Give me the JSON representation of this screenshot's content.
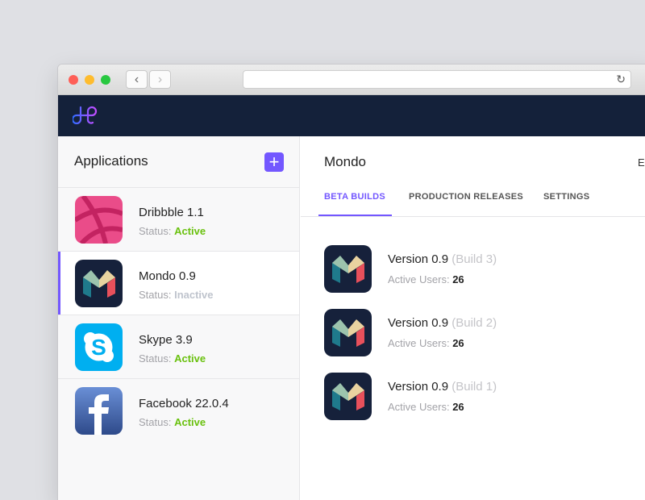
{
  "browser": {
    "back": "‹",
    "forward": "›",
    "reload": "↻",
    "url": ""
  },
  "sidebar": {
    "title": "Applications",
    "add_label": "+",
    "apps": [
      {
        "name": "Dribbble 1.1",
        "status_label": "Status:",
        "status": "Active",
        "icon": "dribbble-icon"
      },
      {
        "name": "Mondo 0.9",
        "status_label": "Status:",
        "status": "Inactive",
        "icon": "mondo-icon"
      },
      {
        "name": "Skype 3.9",
        "status_label": "Status:",
        "status": "Active",
        "icon": "skype-icon"
      },
      {
        "name": "Facebook 22.0.4",
        "status_label": "Status:",
        "status": "Active",
        "icon": "facebook-icon"
      }
    ]
  },
  "main": {
    "title": "Mondo",
    "edit": "Edit",
    "tabs": [
      {
        "label": "BETA BUILDS"
      },
      {
        "label": "PRODUCTION RELEASES"
      },
      {
        "label": "SETTINGS"
      }
    ],
    "builds": [
      {
        "version": "Version 0.9",
        "build": "(Build 3)",
        "users_label": "Active Users:",
        "users": "26"
      },
      {
        "version": "Version 0.9",
        "build": "(Build 2)",
        "users_label": "Active Users:",
        "users": "26"
      },
      {
        "version": "Version 0.9",
        "build": "(Build 1)",
        "users_label": "Active Users:",
        "users": "26"
      }
    ]
  },
  "colors": {
    "accent": "#7357ff",
    "appbar": "#14213a",
    "active": "#6ac10f",
    "inactive": "#bfc4cd"
  }
}
